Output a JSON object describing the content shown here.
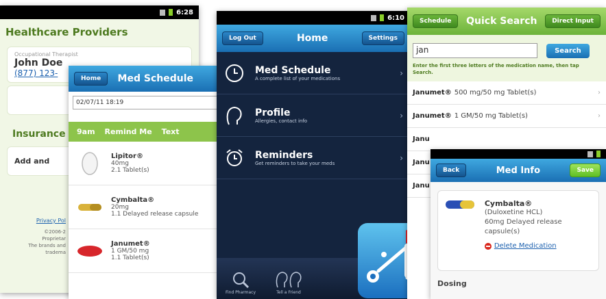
{
  "providers_screen": {
    "status_time": "6:28",
    "title": "Healthcare Providers",
    "occupation": "Occupational Therapist",
    "provider_name": "John Doe",
    "provider_phone": "(877) 123-",
    "add_label": "Add",
    "insurance_title": "Insurance",
    "add_insurance_label": "Add and",
    "footer_link": "Privacy Pol",
    "footer_lines": [
      "©2006-2",
      "Proprietar",
      "The brands and",
      "tradema"
    ]
  },
  "schedule_screen": {
    "home_button": "Home",
    "title": "Med Schedule",
    "date_value": "02/07/11 18:19",
    "tabs": [
      "9am",
      "Remind Me",
      "Text"
    ],
    "meds": [
      {
        "name": "Lipitor®",
        "dose": "40mg",
        "qty": "2.1 Tablet(s)",
        "pill": "white-round-pill-icon"
      },
      {
        "name": "Cymbalta®",
        "dose": "20mg",
        "qty": "1.1 Delayed release capsule",
        "pill": "yellow-capsule-icon"
      },
      {
        "name": "Janumet®",
        "dose": "1 GM/50 mg",
        "qty": "1.1 Tablet(s)",
        "pill": "red-oval-pill-icon"
      }
    ]
  },
  "home_screen": {
    "status_time": "6:10",
    "logout_button": "Log Out",
    "title": "Home",
    "settings_button": "Settings",
    "menu": [
      {
        "title": "Med Schedule",
        "subtitle": "A complete list of your medications",
        "icon": "clock-icon"
      },
      {
        "title": "Profile",
        "subtitle": "Allergies, contact info",
        "icon": "profile-icon"
      },
      {
        "title": "Reminders",
        "subtitle": "Get reminders to take your meds",
        "icon": "alarm-clock-icon"
      }
    ],
    "bottom": [
      {
        "label": "Find Pharmacy",
        "icon": "find-pharmacy-icon"
      },
      {
        "label": "Tell a Friend",
        "icon": "tell-a-friend-icon"
      }
    ]
  },
  "search_screen": {
    "schedule_button": "Schedule",
    "title": "Quick Search",
    "direct_input_button": "Direct Input",
    "search_value": "jan",
    "search_button": "Search",
    "hint": "Enter the first three letters of the medication name, then tap Search.",
    "results": [
      {
        "brand": "Janumet®",
        "detail": "500 mg/50 mg Tablet(s)"
      },
      {
        "brand": "Janumet®",
        "detail": "1 GM/50 mg Tablet(s)"
      },
      {
        "brand": "Janu",
        "detail": ""
      },
      {
        "brand": "Janu",
        "detail": ""
      },
      {
        "brand": "Janu",
        "detail": ""
      }
    ]
  },
  "info_screen": {
    "back_button": "Back",
    "title": "Med Info",
    "save_button": "Save",
    "name": "Cymbalta®",
    "generic": "(Duloxetine HCL)",
    "dose": "60mg Delayed release capsule(s)",
    "delete_label": "Delete Medication",
    "dosing_label": "Dosing"
  }
}
